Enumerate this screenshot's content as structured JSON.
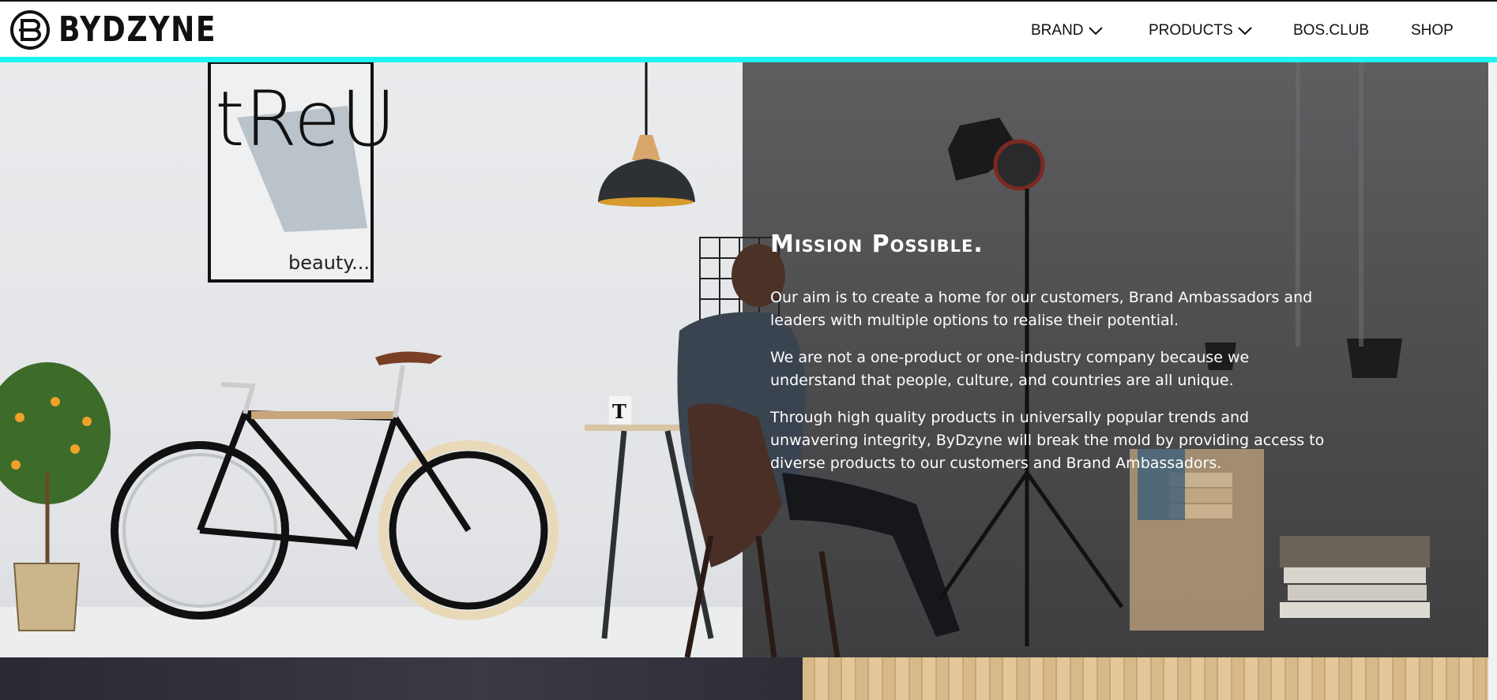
{
  "header": {
    "logo_text": "BYDZYNE",
    "nav": [
      {
        "label": "BRAND",
        "has_dropdown": true
      },
      {
        "label": "PRODUCTS",
        "has_dropdown": true
      },
      {
        "label": "BOS.CLUB",
        "has_dropdown": false
      },
      {
        "label": "SHOP",
        "has_dropdown": false
      }
    ],
    "accent_color": "#1cf5f0"
  },
  "hero": {
    "poster_text": "tReU",
    "poster_caption": "beauty...",
    "mug_letter": "T",
    "title": "Mission Possible.",
    "paragraphs": [
      "Our aim is to create a home for our customers, Brand Ambassadors and leaders with multiple options to realise their potential.",
      "We are not a one-product or one-industry company because we understand that people, culture, and countries are all unique.",
      "Through high quality products in universally popular trends and unwavering integrity, ByDzyne will break the mold by providing access to diverse products to our customers and Brand Ambassadors."
    ]
  },
  "icons": {
    "logo": "bydzyne-logo-icon",
    "dropdown": "chevron-down-icon"
  }
}
